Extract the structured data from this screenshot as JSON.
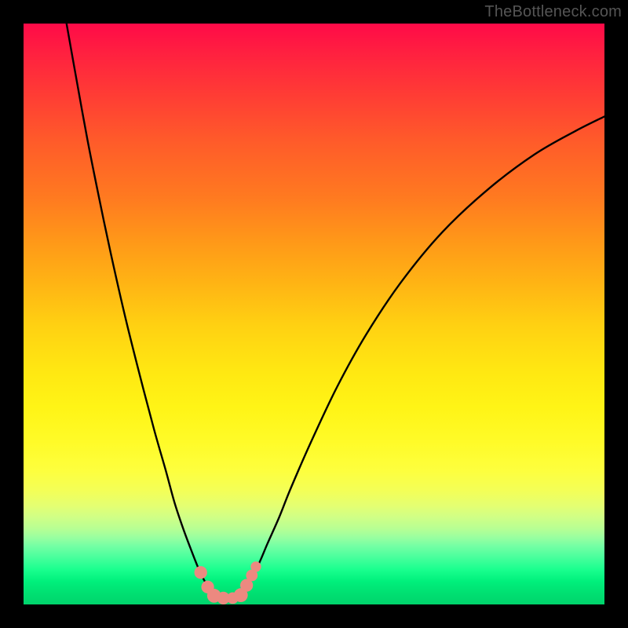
{
  "watermark": "TheBottleneck.com",
  "chart_data": {
    "type": "line",
    "title": "",
    "xlabel": "",
    "ylabel": "",
    "xlim": [
      0,
      100
    ],
    "ylim": [
      0,
      100
    ],
    "grid": false,
    "legend": false,
    "colors": {
      "curve": "#000000",
      "markers": "#ec8980",
      "gradient_top": "#ff0a48",
      "gradient_bottom": "#00d46c"
    },
    "series": [
      {
        "name": "bottleneck-curve",
        "x": [
          7.4,
          9.0,
          11.0,
          13.0,
          15.0,
          17.5,
          20.0,
          22.5,
          24.5,
          26.0,
          27.5,
          29.0,
          30.2,
          31.3,
          32.4,
          33.5,
          37.0,
          38.0,
          39.0,
          40.5,
          42.0,
          44.0,
          46.0,
          49.5,
          54.0,
          59.0,
          65.0,
          72.0,
          80.0,
          88.0,
          95.0,
          100.0
        ],
        "y": [
          100.0,
          91.0,
          80.0,
          70.0,
          60.5,
          49.5,
          39.5,
          30.0,
          23.0,
          17.5,
          13.0,
          9.0,
          6.0,
          3.8,
          2.2,
          1.2,
          1.2,
          2.5,
          4.3,
          7.0,
          10.5,
          15.0,
          20.0,
          28.0,
          37.5,
          46.5,
          55.5,
          64.0,
          71.5,
          77.5,
          81.5,
          84.0
        ]
      }
    ],
    "markers": {
      "name": "highlight-points",
      "points": [
        {
          "x": 30.5,
          "y": 5.5,
          "r": 1.1
        },
        {
          "x": 31.7,
          "y": 3.0,
          "r": 1.1
        },
        {
          "x": 32.8,
          "y": 1.5,
          "r": 1.2
        },
        {
          "x": 34.4,
          "y": 1.1,
          "r": 1.1
        },
        {
          "x": 36.0,
          "y": 1.1,
          "r": 1.0
        },
        {
          "x": 37.4,
          "y": 1.6,
          "r": 1.2
        },
        {
          "x": 38.4,
          "y": 3.3,
          "r": 1.1
        },
        {
          "x": 39.3,
          "y": 5.0,
          "r": 1.0
        },
        {
          "x": 40.0,
          "y": 6.5,
          "r": 0.9
        }
      ]
    }
  }
}
